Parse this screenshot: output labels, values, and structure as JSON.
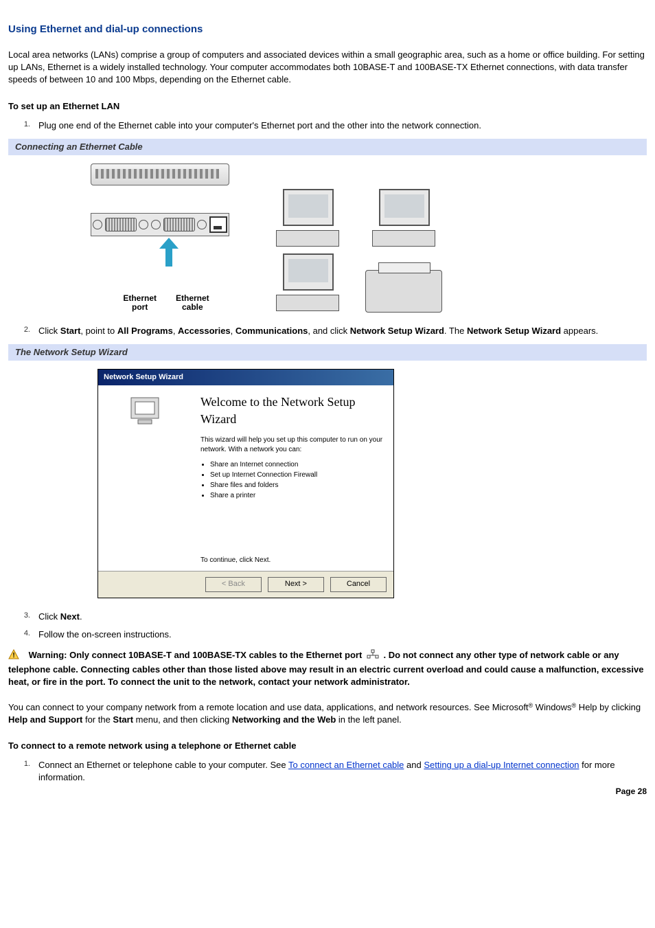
{
  "title": "Using Ethernet and dial-up connections",
  "intro": "Local area networks (LANs) comprise a group of computers and associated devices within a small geographic area, such as a home or office building. For setting up LANs, Ethernet is a widely installed technology. Your computer accommodates both 10BASE-T and 100BASE-TX Ethernet connections, with data transfer speeds of between 10 and 100 Mbps, depending on the Ethernet cable.",
  "section1_head": "To set up an Ethernet LAN",
  "steps1": {
    "s1": "Plug one end of the Ethernet cable into your computer's Ethernet port and the other into the network connection."
  },
  "caption1": "Connecting an Ethernet Cable",
  "diag_labels": {
    "port": "Ethernet\nport",
    "cable": "Ethernet\ncable"
  },
  "step2_prefix": "Click ",
  "step2_b1": "Start",
  "step2_m1": ", point to ",
  "step2_b2": "All Programs",
  "step2_m2": ", ",
  "step2_b3": "Accessories",
  "step2_m3": ", ",
  "step2_b4": "Communications",
  "step2_m4": ", and click ",
  "step2_b5": "Network Setup Wizard",
  "step2_m5": ". The ",
  "step2_b6": "Network Setup Wizard",
  "step2_m6": " appears.",
  "caption2": "The Network Setup Wizard",
  "wizard": {
    "titlebar": "Network Setup Wizard",
    "heading": "Welcome to the Network Setup Wizard",
    "desc": "This wizard will help you set up this computer to run on your network. With a network you can:",
    "bullets": [
      "Share an Internet connection",
      "Set up Internet Connection Firewall",
      "Share files and folders",
      "Share a printer"
    ],
    "cont": "To continue, click Next.",
    "btn_back": "< Back",
    "btn_next": "Next >",
    "btn_cancel": "Cancel"
  },
  "step3_prefix": "Click ",
  "step3_b1": "Next",
  "step3_suffix": ".",
  "step4": "Follow the on-screen instructions.",
  "warn_b_lead": "Warning: Only connect 10BASE-T and 100BASE-TX cables to the Ethernet port ",
  "warn_b_tail": " . Do not connect any other type of network cable or any telephone cable. Connecting cables other than those listed above may result in an electric current overload and could cause a malfunction, excessive heat, or fire in the port. To connect the unit to the network, contact your network administrator.",
  "para_remote_1": "You can connect to your company network from a remote location and use data, applications, and network resources. See Microsoft",
  "reg": "®",
  "para_remote_2": " Windows",
  "para_remote_3": " Help by clicking ",
  "para_remote_b1": "Help and Support",
  "para_remote_4": " for the ",
  "para_remote_b2": "Start",
  "para_remote_5": " menu, and then clicking ",
  "para_remote_b3": "Networking and the Web",
  "para_remote_6": " in the left panel.",
  "section2_head": "To connect to a remote network using a telephone or Ethernet cable",
  "steps2": {
    "s1_a": "Connect an Ethernet or telephone cable to your computer. See ",
    "s1_link1": "To connect an Ethernet cable",
    "s1_b": " and ",
    "s1_link2": "Setting up a dial-up Internet connection",
    "s1_c": " for more information."
  },
  "page": "Page 28"
}
